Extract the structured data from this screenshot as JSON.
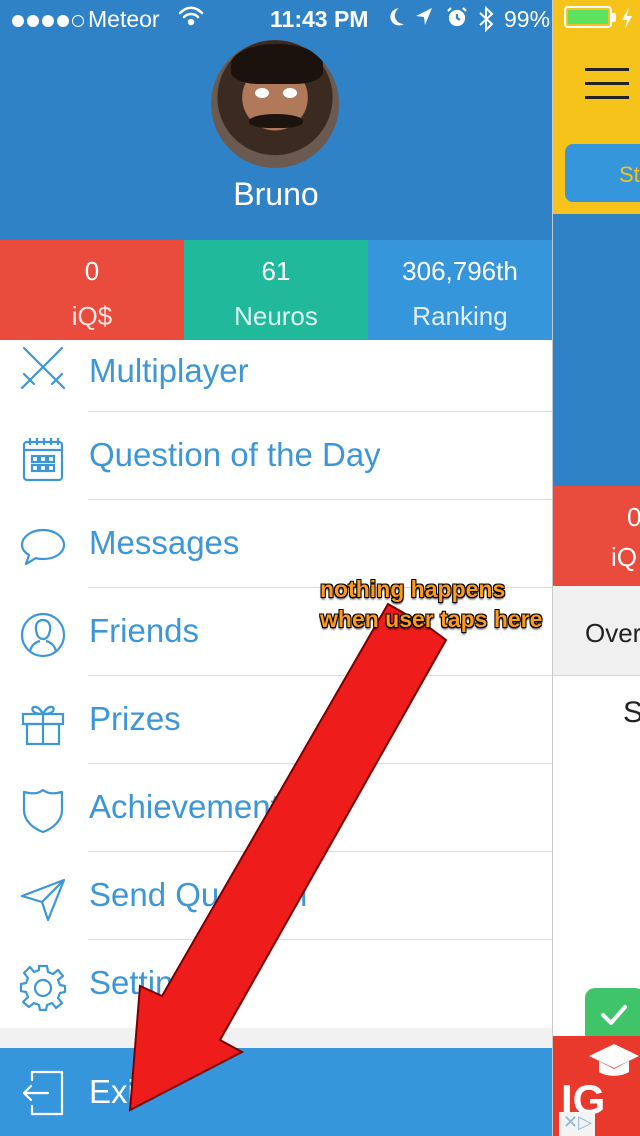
{
  "status_bar": {
    "carrier": "Meteor",
    "time": "11:43 PM",
    "battery_percent": "99%",
    "signal_bars_filled": 4,
    "signal_bars_total": 5
  },
  "profile": {
    "name": "Bruno"
  },
  "stats": [
    {
      "value": "0",
      "label": "iQ$",
      "color": "#e94b3c"
    },
    {
      "value": "61",
      "label": "Neuros",
      "color": "#20b99b"
    },
    {
      "value": "306,796th",
      "label": "Ranking",
      "color": "#3596dc"
    }
  ],
  "menu": {
    "items": [
      {
        "label": "Multiplayer",
        "icon": "crossed-swords-icon"
      },
      {
        "label": "Question of the Day",
        "icon": "calendar-icon"
      },
      {
        "label": "Messages",
        "icon": "speech-bubble-icon"
      },
      {
        "label": "Friends",
        "icon": "person-icon"
      },
      {
        "label": "Prizes",
        "icon": "gift-icon"
      },
      {
        "label": "Achievements",
        "icon": "shield-icon"
      },
      {
        "label": "Send Question",
        "icon": "paper-plane-icon"
      },
      {
        "label": "Settings",
        "icon": "gear-icon"
      }
    ],
    "exit_label": "Exit"
  },
  "main_peek": {
    "button_text": "St",
    "stat_value": "0",
    "stat_label": "iQ",
    "tab_text": "Over",
    "letter": "S",
    "ad_logo": "IG"
  },
  "annotation": {
    "line1": "nothing happens",
    "line2": "when user taps here",
    "color": "#ff9a1c"
  },
  "colors": {
    "header_blue": "#2f82c6",
    "menu_text_blue": "#3d97d6",
    "exit_bar_blue": "#3596dc",
    "peek_yellow": "#f5c319",
    "arrow_red": "#ef1c1c"
  }
}
